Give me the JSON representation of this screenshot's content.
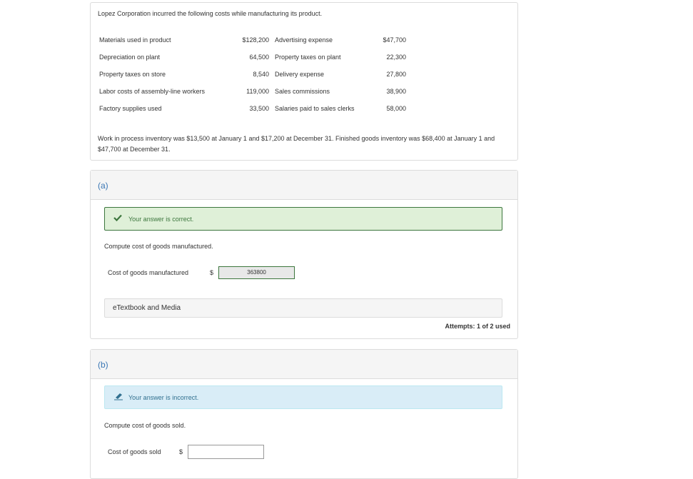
{
  "problem": {
    "intro": "Lopez Corporation incurred the following costs while manufacturing its product.",
    "costs": [
      {
        "label": "Materials used in product",
        "amount": "$128,200",
        "label2": "Advertising expense",
        "amount2": "$47,700"
      },
      {
        "label": "Depreciation on plant",
        "amount": "64,500",
        "label2": "Property taxes on plant",
        "amount2": "22,300"
      },
      {
        "label": "Property taxes on store",
        "amount": "8,540",
        "label2": "Delivery expense",
        "amount2": "27,800"
      },
      {
        "label": "Labor costs of assembly-line workers",
        "amount": "119,000",
        "label2": "Sales commissions",
        "amount2": "38,900"
      },
      {
        "label": "Factory supplies used",
        "amount": "33,500",
        "label2": "Salaries paid to sales clerks",
        "amount2": "58,000"
      }
    ],
    "inventory_text": "Work in process inventory was $13,500 at January 1 and $17,200 at December 31. Finished goods inventory was $68,400 at January 1 and $47,700 at December 31."
  },
  "part_a": {
    "letter": "(a)",
    "feedback": "Your answer is correct.",
    "prompt": "Compute cost of goods manufactured.",
    "field_label": "Cost of goods manufactured",
    "currency": "$",
    "value": "363800",
    "etextbook": "eTextbook and Media",
    "attempts": "Attempts: 1 of 2 used"
  },
  "part_b": {
    "letter": "(b)",
    "feedback": "Your answer is incorrect.",
    "prompt": "Compute cost of goods sold.",
    "field_label": "Cost of goods sold",
    "currency": "$",
    "value": ""
  },
  "colors": {
    "correct_bg": "#dff0d8",
    "correct_border": "#3c763d",
    "incorrect_bg": "#d9edf7",
    "part_letter": "#3a77b5"
  },
  "icons": {
    "correct": "checkmark-icon",
    "incorrect": "pencil-icon"
  }
}
